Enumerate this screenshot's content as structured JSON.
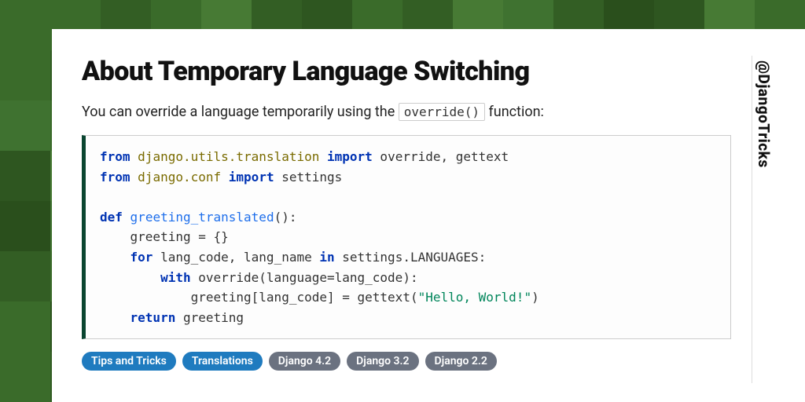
{
  "title": "About Temporary Language Switching",
  "lead_prefix": "You can override a language temporarily using the ",
  "lead_code": "override()",
  "lead_suffix": " function:",
  "code": {
    "l1_kw1": "from",
    "l1_mod": "django.utils.translation",
    "l1_kw2": "import",
    "l1_rest": " override, gettext",
    "l2_kw1": "from",
    "l2_mod": "django.conf",
    "l2_kw2": "import",
    "l2_rest": " settings",
    "l3_kw": "def",
    "l3_fn": "greeting_translated",
    "l3_rest": "():",
    "l4": "    greeting = {}",
    "l5_pre": "    ",
    "l5_kw1": "for",
    "l5_mid": " lang_code, lang_name ",
    "l5_kw2": "in",
    "l5_rest": " settings.LANGUAGES:",
    "l6_pre": "        ",
    "l6_kw": "with",
    "l6_rest": " override(language=lang_code):",
    "l7_pre": "            greeting[lang_code] = gettext(",
    "l7_str": "\"Hello, World!\"",
    "l7_post": ")",
    "l8_pre": "    ",
    "l8_kw": "return",
    "l8_rest": " greeting"
  },
  "tags": {
    "t1": "Tips and Tricks",
    "t2": "Translations",
    "t3": "Django 4.2",
    "t4": "Django 3.2",
    "t5": "Django 2.2"
  },
  "handle": "@DjangoTricks"
}
